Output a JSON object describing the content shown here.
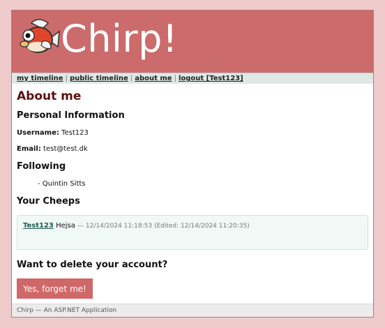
{
  "header": {
    "brand": "Chirp!",
    "logo_icon": "fish-bird-mascot-icon",
    "colors": {
      "header_bg": "#cc6b6b",
      "page_bg": "#efcaca"
    }
  },
  "nav": {
    "my_timeline": "my timeline",
    "public_timeline": "public timeline",
    "about_me": "about me",
    "logout": "logout [Test123]",
    "separator": "|"
  },
  "main": {
    "title": "About me",
    "personal_heading": "Personal Information",
    "username_label": "Username:",
    "username_value": "Test123",
    "email_label": "Email:",
    "email_value": "test@test.dk",
    "following_heading": "Following",
    "following": [
      {
        "name": "- Quintin Sitts"
      }
    ],
    "cheeps_heading": "Your Cheeps",
    "cheeps": [
      {
        "author": "Test123",
        "text": "Hejsa",
        "meta": "— 12/14/2024 11:18:53 (Edited: 12/14/2024 11:20:35)"
      }
    ],
    "delete_heading": "Want to delete your account?",
    "delete_button": "Yes, forget me!"
  },
  "footer": {
    "text": "Chirp — An ASP.NET Application"
  }
}
